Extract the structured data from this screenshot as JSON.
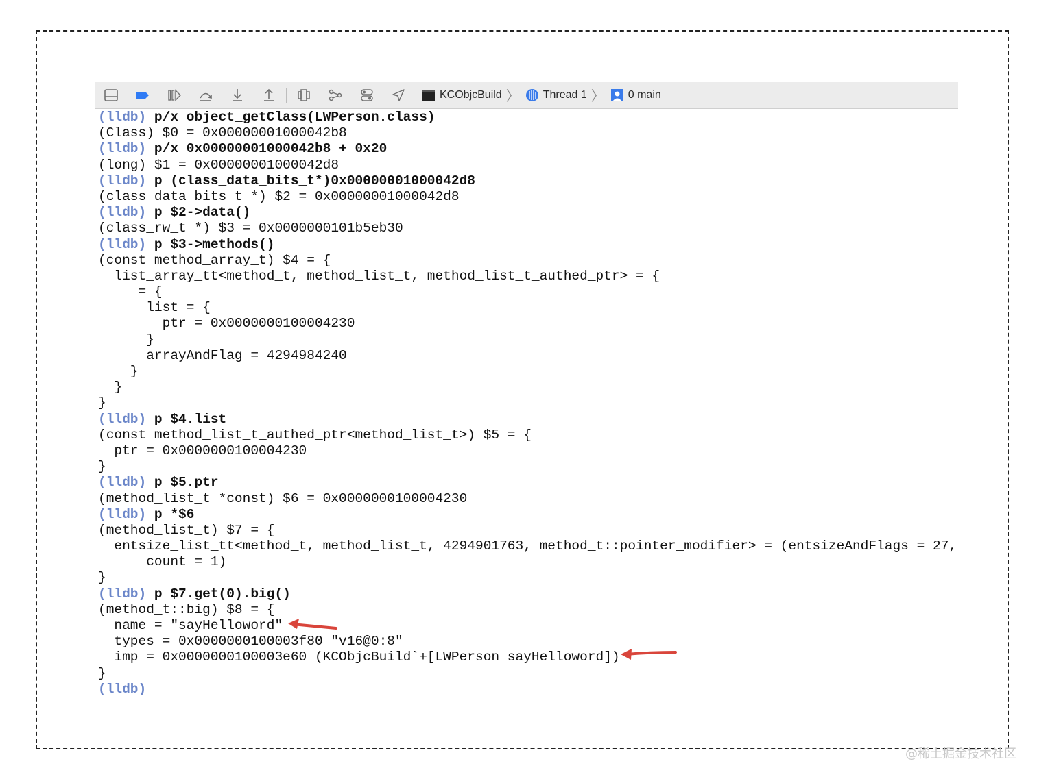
{
  "toolbar": {
    "breadcrumb": [
      {
        "label": "KCObjcBuild",
        "icon": "terminal-icon"
      },
      {
        "label": "Thread 1",
        "icon": "thread-icon"
      },
      {
        "label": "0 main",
        "icon": "frame-icon"
      }
    ]
  },
  "console": {
    "prompt": "(lldb)",
    "lines": [
      {
        "type": "cmd",
        "text": "p/x object_getClass(LWPerson.class)"
      },
      {
        "type": "out",
        "text": "(Class) $0 = 0x00000001000042b8"
      },
      {
        "type": "cmd",
        "text": "p/x 0x00000001000042b8 + 0x20"
      },
      {
        "type": "out",
        "text": "(long) $1 = 0x00000001000042d8"
      },
      {
        "type": "cmd",
        "text": "p (class_data_bits_t*)0x00000001000042d8"
      },
      {
        "type": "out",
        "text": "(class_data_bits_t *) $2 = 0x00000001000042d8"
      },
      {
        "type": "cmd",
        "text": "p $2->data()"
      },
      {
        "type": "out",
        "text": "(class_rw_t *) $3 = 0x0000000101b5eb30"
      },
      {
        "type": "cmd",
        "text": "p $3->methods()"
      },
      {
        "type": "out",
        "text": "(const method_array_t) $4 = {"
      },
      {
        "type": "out",
        "text": "  list_array_tt<method_t, method_list_t, method_list_t_authed_ptr> = {"
      },
      {
        "type": "out",
        "text": "     = {"
      },
      {
        "type": "out",
        "text": "      list = {"
      },
      {
        "type": "out",
        "text": "        ptr = 0x0000000100004230"
      },
      {
        "type": "out",
        "text": "      }"
      },
      {
        "type": "out",
        "text": "      arrayAndFlag = 4294984240"
      },
      {
        "type": "out",
        "text": "    }"
      },
      {
        "type": "out",
        "text": "  }"
      },
      {
        "type": "out",
        "text": "}"
      },
      {
        "type": "cmd",
        "text": "p $4.list"
      },
      {
        "type": "out",
        "text": "(const method_list_t_authed_ptr<method_list_t>) $5 = {"
      },
      {
        "type": "out",
        "text": "  ptr = 0x0000000100004230"
      },
      {
        "type": "out",
        "text": "}"
      },
      {
        "type": "cmd",
        "text": "p $5.ptr"
      },
      {
        "type": "out",
        "text": "(method_list_t *const) $6 = 0x0000000100004230"
      },
      {
        "type": "cmd",
        "text": "p *$6"
      },
      {
        "type": "out",
        "text": "(method_list_t) $7 = {"
      },
      {
        "type": "out",
        "text": "  entsize_list_tt<method_t, method_list_t, 4294901763, method_t::pointer_modifier> = (entsizeAndFlags = 27,"
      },
      {
        "type": "out",
        "text": "      count = 1)"
      },
      {
        "type": "out",
        "text": "}"
      },
      {
        "type": "cmd",
        "text": "p $7.get(0).big()"
      },
      {
        "type": "out",
        "text": "(method_t::big) $8 = {"
      },
      {
        "type": "out",
        "text": "  name = \"sayHelloword\""
      },
      {
        "type": "out",
        "text": "  types = 0x0000000100003f80 \"v16@0:8\""
      },
      {
        "type": "out",
        "text": "  imp = 0x0000000100003e60 (KCObjcBuild`+[LWPerson sayHelloword])"
      },
      {
        "type": "out",
        "text": "}"
      },
      {
        "type": "cmd",
        "text": ""
      }
    ]
  },
  "annotations": {
    "arrow_color": "#d9453b"
  },
  "watermark": "@稀土掘金技术社区"
}
